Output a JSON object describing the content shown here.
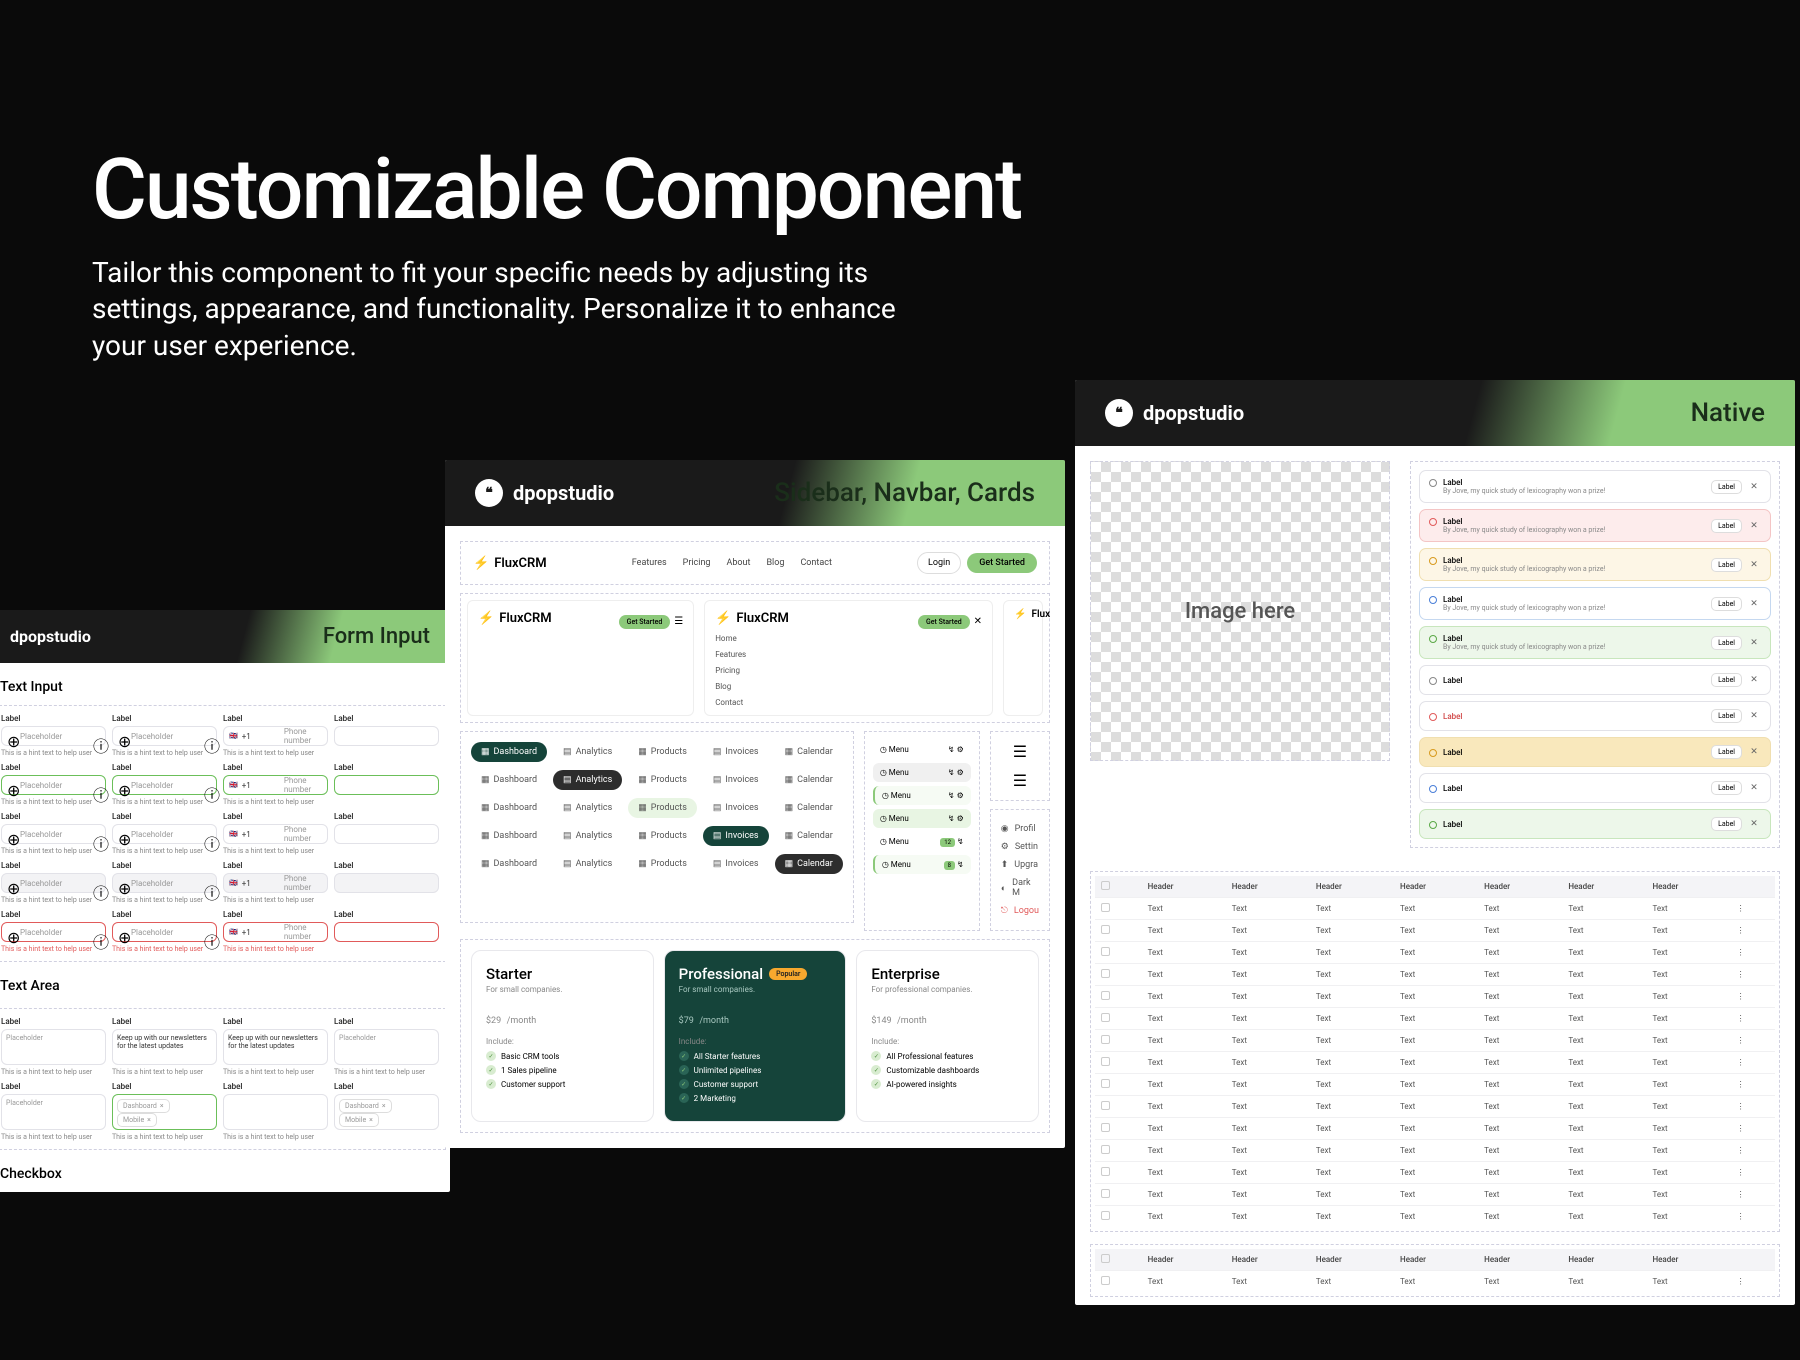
{
  "hero": {
    "title": "Customizable Component",
    "subtitle": "Tailor this component to fit your specific needs by adjusting its settings, appearance, and functionality. Personalize it to enhance your user experience."
  },
  "brand": {
    "name": "dpopstudio"
  },
  "panels": {
    "form": {
      "title": "Form Input"
    },
    "mid": {
      "title": "Sidebar, Navbar, Cards"
    },
    "native": {
      "title": "Native"
    }
  },
  "formSection": {
    "textInput": "Text Input",
    "textArea": "Text Area",
    "checkbox": "Checkbox",
    "label": "Label",
    "placeholder": "Placeholder",
    "phone": "Phone number",
    "prefix": "+1",
    "hint": "This is a hint text to help user",
    "taFill": "Keep up with our newsletters for the latest updates",
    "dashboard": "Dashboard",
    "mobile": "Mobile"
  },
  "crm": {
    "brand": "FluxCRM",
    "brandCut": "Flux",
    "nav": [
      "Features",
      "Pricing",
      "About",
      "Blog",
      "Contact"
    ],
    "login": "Login",
    "cta": "Get Started",
    "menu": {
      "home": "Home",
      "features": "Features",
      "pricing": "Pricing",
      "blog": "Blog",
      "contact": "Contact"
    }
  },
  "tabs": {
    "dashboard": "Dashboard",
    "analytics": "Analytics",
    "products": "Products",
    "invoices": "Invoices",
    "calendar": "Calendar"
  },
  "sideMenu": {
    "label": "Menu"
  },
  "userMenu": {
    "profile": "Profil",
    "settings": "Settin",
    "upgrade": "Upgra",
    "dark": "Dark M",
    "logout": "Logou"
  },
  "pricing": {
    "starter": {
      "name": "Starter",
      "sub": "For small companies.",
      "price": "$29",
      "period": "/month",
      "include": "Include:",
      "f1": "Basic CRM tools",
      "f2": "1 Sales pipeline",
      "f3": "Customer support"
    },
    "pro": {
      "name": "Professional",
      "badge": "Popular",
      "sub": "For small companies.",
      "price": "$79",
      "period": "/month",
      "include": "Include:",
      "f1": "All Starter features",
      "f2": "Unlimited pipelines",
      "f3": "Customer support",
      "f4": "2 Marketing"
    },
    "ent": {
      "name": "Enterprise",
      "sub": "For professional companies.",
      "price": "$149",
      "period": "/month",
      "include": "Include:",
      "f1": "All Professional features",
      "f2": "Customizable dashboards",
      "f3": "AI-powered insights"
    }
  },
  "native": {
    "imgPh": "Image here",
    "alert": {
      "title": "Label",
      "sub": "By Jove, my quick study of lexicography won a prize!",
      "tag": "Label"
    }
  },
  "table": {
    "header": "Header",
    "cell": "Text"
  }
}
